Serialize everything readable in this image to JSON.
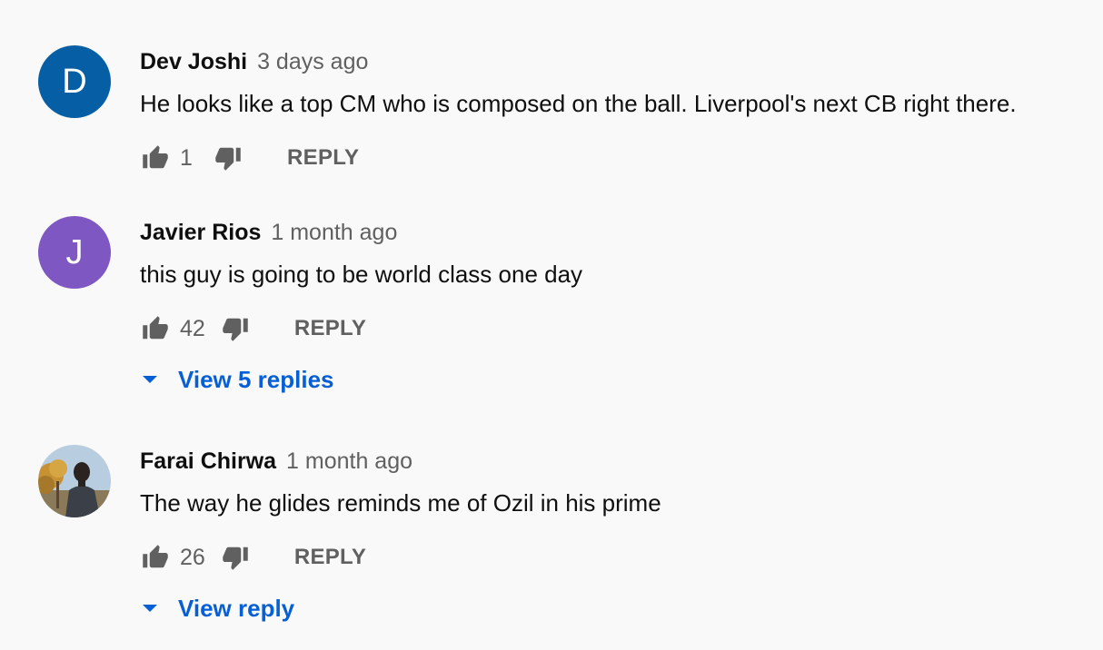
{
  "comments": [
    {
      "avatar_letter": "D",
      "avatar_color": "#065fa4",
      "author": "Dev Joshi",
      "time": "3 days ago",
      "text": "He looks like a top CM who is composed on the ball. Liverpool's next CB right there.",
      "likes": "1",
      "reply_label": "REPLY"
    },
    {
      "avatar_letter": "J",
      "avatar_color": "#7e57c2",
      "author": "Javier Rios",
      "time": "1 month ago",
      "text": "this guy is going to be world class one day",
      "likes": "42",
      "reply_label": "REPLY",
      "view_replies_label": "View 5 replies"
    },
    {
      "avatar_icon": "profile-photo",
      "author": "Farai Chirwa",
      "time": "1 month ago",
      "text": "The way he glides reminds me of Ozil in his prime",
      "likes": "26",
      "reply_label": "REPLY",
      "view_replies_label": "View reply"
    }
  ],
  "colors": {
    "background": "#f9f9f9",
    "link": "#065fd4",
    "secondary_text": "#606060",
    "icon": "#606060"
  },
  "icons": {
    "like": "thumbs-up-icon",
    "dislike": "thumbs-down-icon",
    "expand": "caret-down-icon"
  }
}
